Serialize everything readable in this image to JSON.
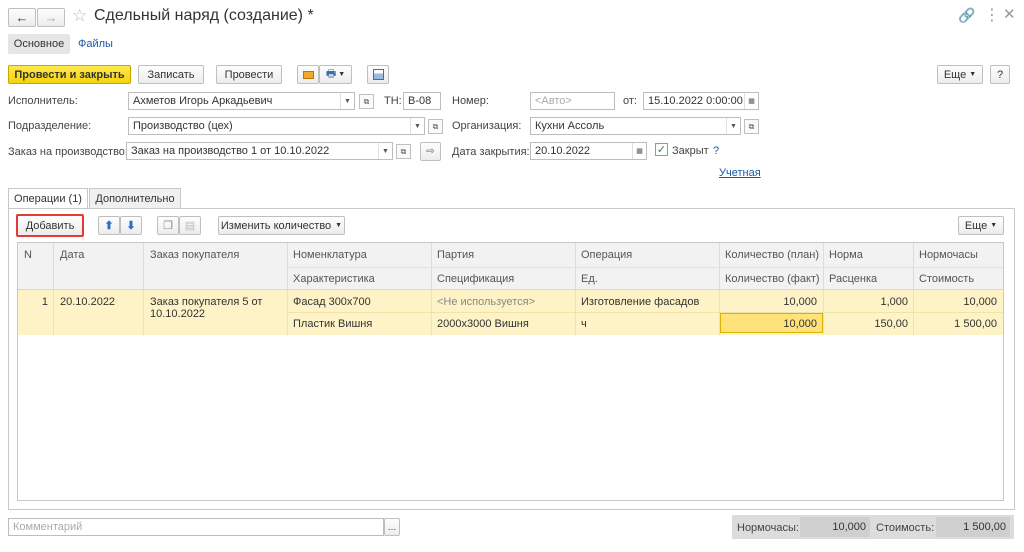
{
  "window": {
    "title": "Сдельный наряд (создание) *"
  },
  "tabs_top": {
    "main": "Основное",
    "files": "Файлы"
  },
  "toolbar": {
    "post_close": "Провести и закрыть",
    "save": "Записать",
    "post": "Провести",
    "more": "Еще",
    "help": "?"
  },
  "form": {
    "executor_label": "Исполнитель:",
    "executor_value": "Ахметов Игорь Аркадьевич",
    "tn_label": "ТН:",
    "tn_value": "В-08",
    "number_label": "Номер:",
    "number_placeholder": "<Авто>",
    "from_label": "от:",
    "from_value": "15.10.2022  0:00:00",
    "dept_label": "Подразделение:",
    "dept_value": "Производство (цех)",
    "org_label": "Организация:",
    "org_value": "Кухни Ассоль",
    "order_label": "Заказ на производство:",
    "order_value": "Заказ на производство 1 от 10.10.2022",
    "close_date_label": "Дата закрытия:",
    "close_date_value": "20.10.2022",
    "closed_label": "Закрыт",
    "closed_checked": true,
    "question": "?",
    "accounting_link": "Учетная"
  },
  "inner_tabs": {
    "operations": "Операции (1)",
    "additional": "Дополнительно"
  },
  "table_toolbar": {
    "add": "Добавить",
    "change_qty": "Изменить количество",
    "more": "Еще"
  },
  "table": {
    "headers_row1": [
      "N",
      "Дата",
      "Заказ покупателя",
      "Номенклатура",
      "Партия",
      "Операция",
      "Количество (план)",
      "Норма",
      "Нормочасы"
    ],
    "headers_row2": [
      "Характеристика",
      "Спецификация",
      "Ед.",
      "Количество (факт)",
      "Расценка",
      "Стоимость"
    ],
    "row": {
      "n": "1",
      "date": "20.10.2022",
      "order_line1": "Заказ покупателя 5 от",
      "order_line2": "10.10.2022",
      "nomenclature": "Фасад 300х700",
      "batch": "<Не используется>",
      "operation": "Изготовление фасадов",
      "qty_plan": "10,000",
      "norm": "1,000",
      "norm_hours": "10,000",
      "characteristic": "Пластик Вишня",
      "specification": "2000х3000 Вишня",
      "unit": "ч",
      "qty_fact": "10,000",
      "rate": "150,00",
      "cost": "1 500,00"
    }
  },
  "footer": {
    "comment_placeholder": "Комментарий",
    "norm_hours_label": "Нормочасы:",
    "norm_hours_value": "10,000",
    "cost_label": "Стоимость:",
    "cost_value": "1 500,00"
  },
  "colors": {
    "accent_yellow": "#f5d20f",
    "row_highlight": "#fdf3c6",
    "link": "#1a58a8",
    "add_highlight": "#e53935"
  }
}
